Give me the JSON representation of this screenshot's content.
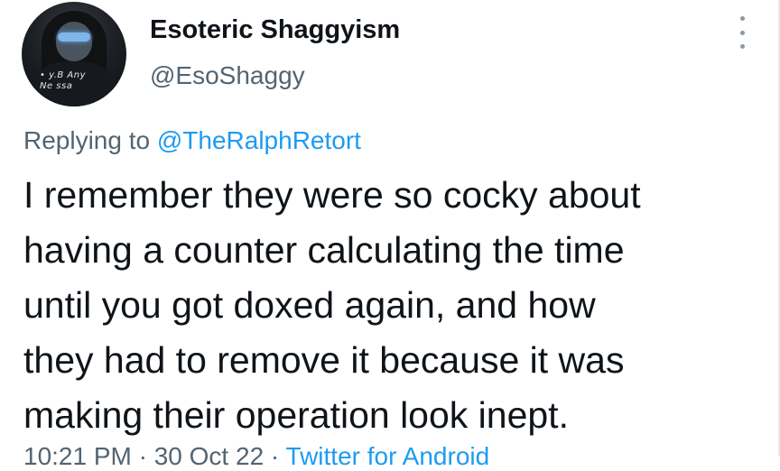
{
  "author": {
    "display_name": "Esoteric Shaggyism",
    "handle": "@EsoShaggy",
    "avatar_shirt_text": [
      "• y.B  Any",
      "Ne  ssa"
    ]
  },
  "reply": {
    "prefix": "Replying to",
    "mention": "@TheRalphRetort"
  },
  "tweet": {
    "lines": [
      "I remember they were so cocky about",
      "having a counter calculating the time",
      "until you got doxed again, and how",
      "they had to remove it because it was",
      "making their operation look inept."
    ]
  },
  "meta": {
    "time_date": "10:21 PM · 30 Oct 22 ·",
    "source": "Twitter for Android"
  },
  "colors": {
    "text": "#0f1419",
    "secondary": "#536471",
    "accent": "#1d9bf0"
  },
  "icons": {
    "more": "more-vertical-icon"
  }
}
